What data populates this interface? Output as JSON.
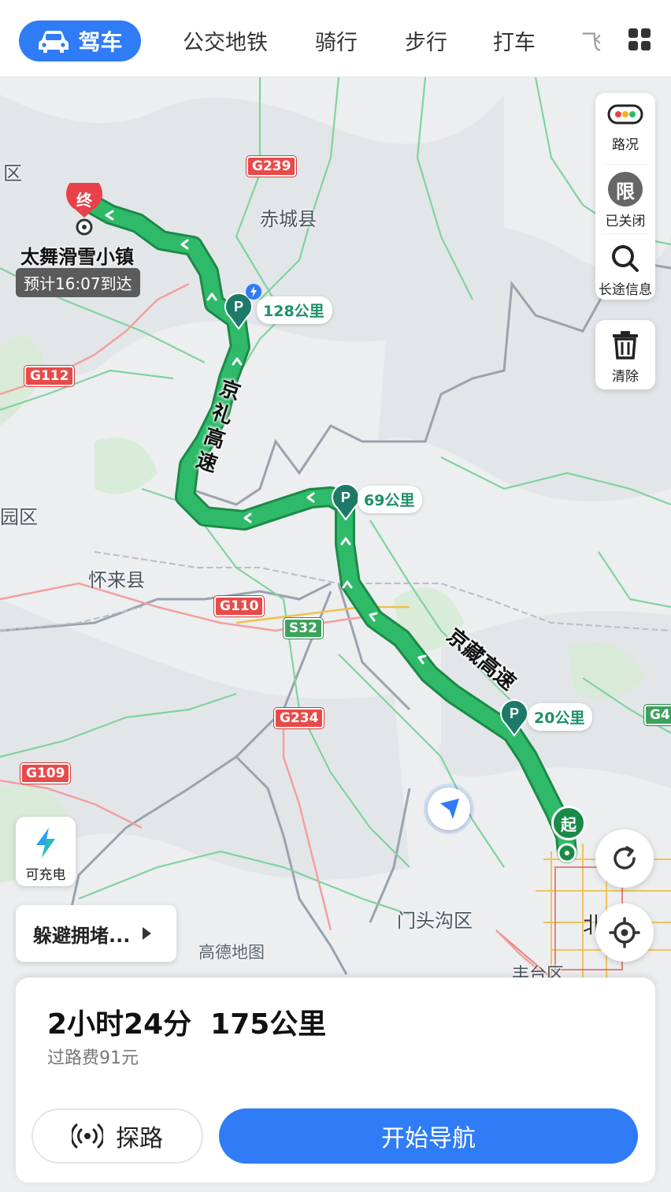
{
  "tabs": {
    "active": "驾车",
    "items": [
      "公交地铁",
      "骑行",
      "步行",
      "打车",
      "飞"
    ]
  },
  "map": {
    "places": {
      "chicheng": "赤城县",
      "huailai": "怀来县",
      "mentougou": "门头沟区",
      "fengtai": "丰台区",
      "beijing": "北",
      "left_edge_top": "区",
      "left_edge_mid": "园区"
    },
    "highways": [
      "G239",
      "G112",
      "G110",
      "S32",
      "G234",
      "G109",
      "G4"
    ],
    "route": {
      "end_marker": "终",
      "start_marker": "起",
      "destination": "太舞滑雪小镇",
      "eta": "预计16:07到达",
      "road1": "京礼高速",
      "road2": "京藏高速",
      "dist1": "128公里",
      "dist2": "69公里",
      "dist3": "20公里"
    },
    "watermark": "高德地图"
  },
  "controls": {
    "traffic": "路况",
    "restrict_icon": "限",
    "restrict": "已关闭",
    "longtrip": "长途信息",
    "clear": "清除",
    "charge": "可充电",
    "avoid": "躲避拥堵..."
  },
  "summary": {
    "duration": "2小时24分",
    "distance": "175公里",
    "toll": "过路费91元",
    "explore": "探路",
    "start_nav": "开始导航"
  },
  "colors": {
    "accent": "#2f7cf6",
    "route": "#2fba6a",
    "destination": "#e8414a"
  }
}
